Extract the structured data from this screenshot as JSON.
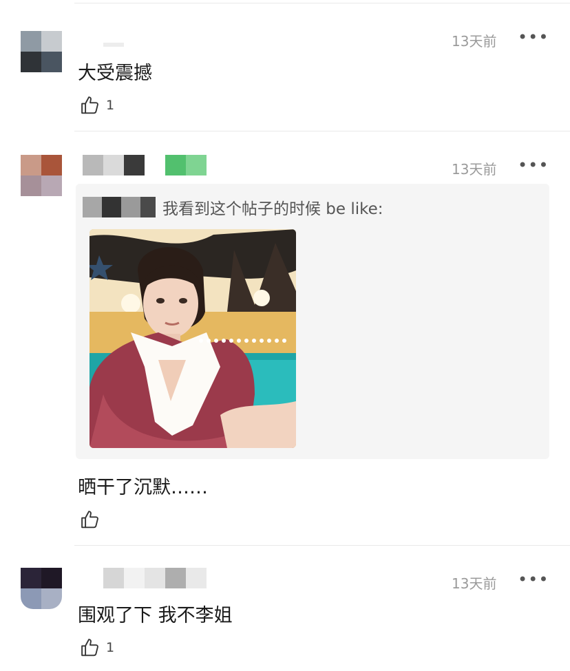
{
  "comments": [
    {
      "time": "13天前",
      "more": "•••",
      "text": "大受震撼",
      "likes": "1"
    },
    {
      "time": "13天前",
      "more": "•••",
      "quote": {
        "text": "我看到这个帖子的时候 be like:"
      },
      "text": "晒干了沉默……",
      "likes": ""
    },
    {
      "time": "13天前",
      "more": "•••",
      "text": "围观了下 我不李姐",
      "likes": "1"
    }
  ],
  "colors": {
    "divider": "#e9e9e9",
    "time": "#9a9a9a",
    "quote_bg": "#f5f5f5"
  },
  "icons": {
    "like": "thumbs-up-icon",
    "more": "more-horizontal-icon"
  }
}
